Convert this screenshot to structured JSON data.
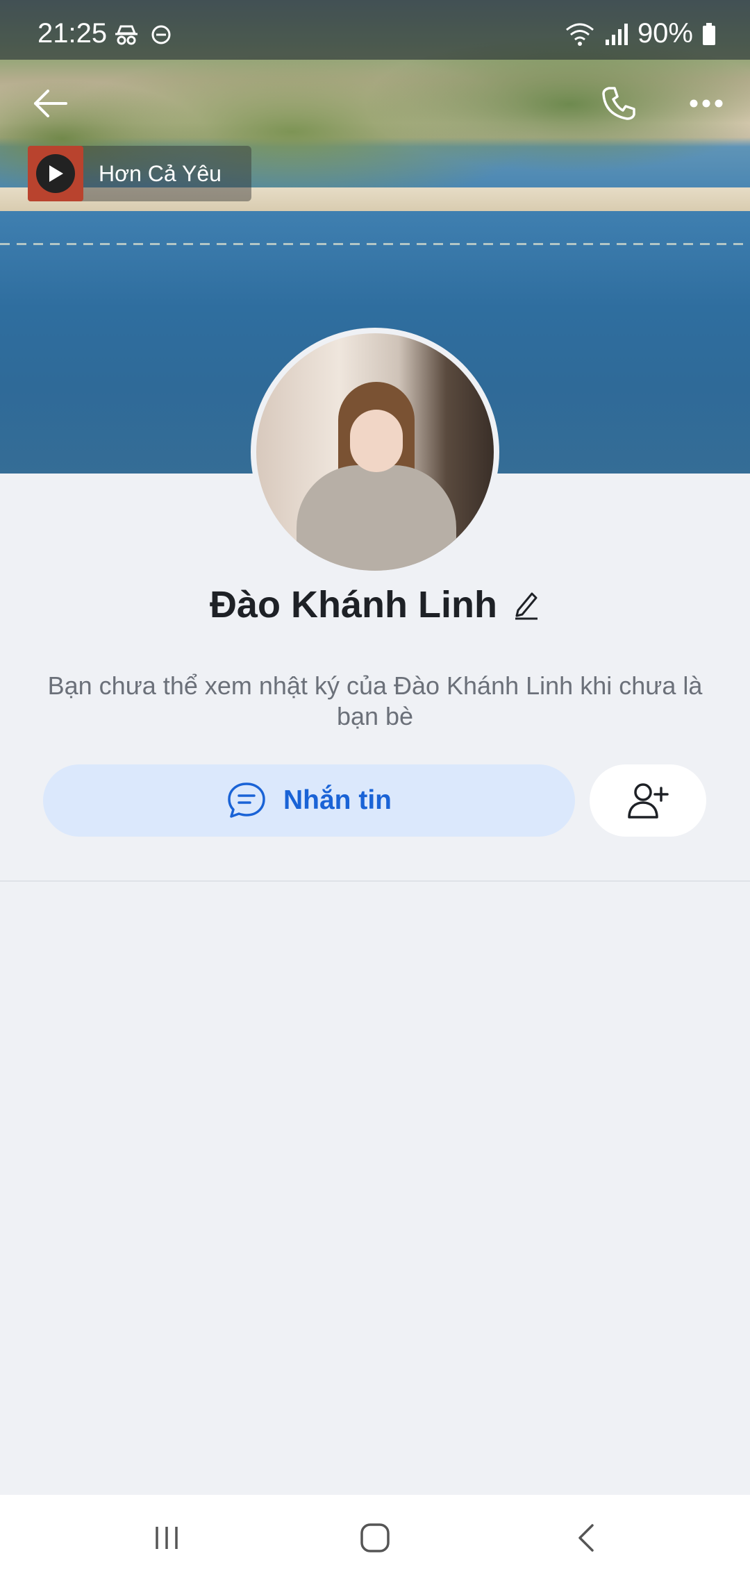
{
  "status_bar": {
    "time": "21:25",
    "battery": "90%"
  },
  "music": {
    "title": "Hơn Cả Yêu"
  },
  "profile": {
    "name": "Đào Khánh Linh",
    "note": "Bạn chưa thể xem nhật ký của Đào Khánh Linh khi chưa là bạn bè"
  },
  "actions": {
    "message_label": "Nhắn tin"
  },
  "colors": {
    "accent": "#1a63d6",
    "message_bg": "#dbe8fc",
    "background": "#eff1f5"
  },
  "icons": {
    "back": "arrow-left-icon",
    "call": "phone-icon",
    "more": "more-dots-icon",
    "add_friend": "add-user-icon",
    "edit": "pencil-icon",
    "chat": "chat-bubble-icon"
  }
}
